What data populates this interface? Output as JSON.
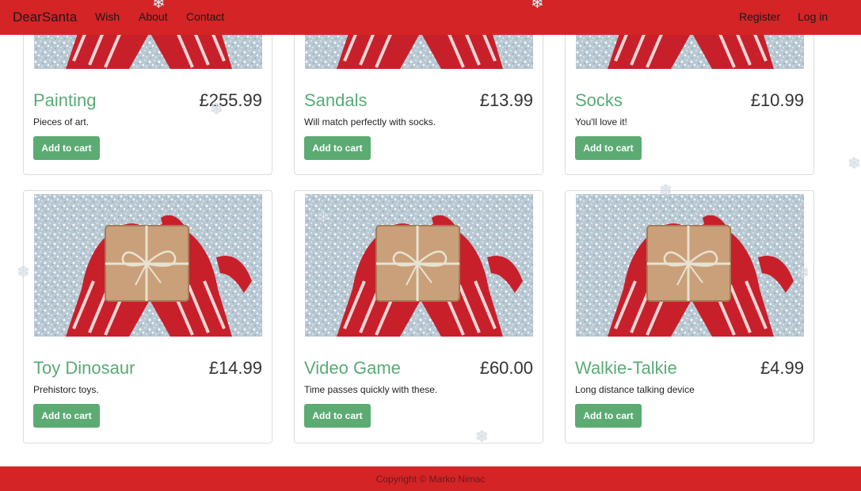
{
  "navbar": {
    "brand": "DearSanta",
    "links": [
      "Wish",
      "About",
      "Contact"
    ],
    "auth": [
      "Register",
      "Log in"
    ],
    "color": "#d42426"
  },
  "products": [
    {
      "name": "Painting",
      "price": "£255.99",
      "description": "Pieces of art.",
      "button": "Add to cart"
    },
    {
      "name": "Sandals",
      "price": "£13.99",
      "description": "Will match perfectly with socks.",
      "button": "Add to cart"
    },
    {
      "name": "Socks",
      "price": "£10.99",
      "description": "You'll love it!",
      "button": "Add to cart"
    },
    {
      "name": "Toy Dinosaur",
      "price": "£14.99",
      "description": "Prehistorc toys.",
      "button": "Add to cart"
    },
    {
      "name": "Video Game",
      "price": "£60.00",
      "description": "Time passes quickly with these.",
      "button": "Add to cart"
    },
    {
      "name": "Walkie-Talkie",
      "price": "£4.99",
      "description": "Long distance talking device",
      "button": "Add to cart"
    }
  ],
  "footer": {
    "copyright": "Copyright © Marko Nimac"
  },
  "colors": {
    "accent": "#5cab73",
    "title": "#5aaa76",
    "brand_red": "#d42426"
  },
  "icons": {
    "snowflake": "❄",
    "product_image": "gift-box-in-red-mittens"
  }
}
